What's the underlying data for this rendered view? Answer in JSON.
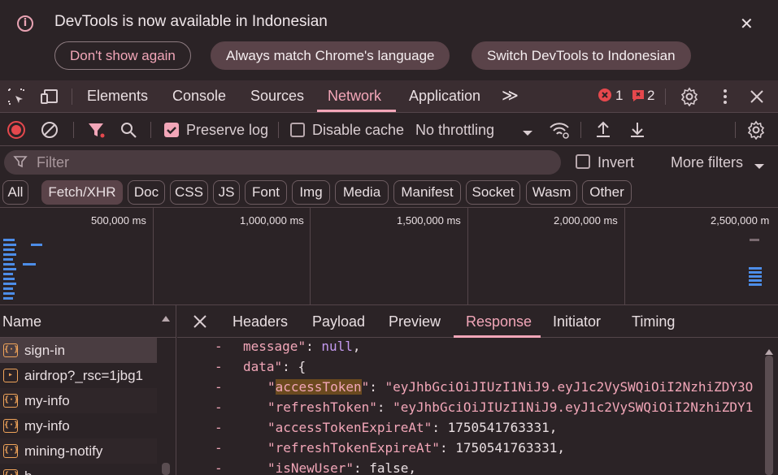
{
  "infobar": {
    "message": "DevTools is now available in Indonesian",
    "dont_show": "Don't show again",
    "always_match": "Always match Chrome's language",
    "switch": "Switch DevTools to Indonesian"
  },
  "main_tabs": {
    "elements": "Elements",
    "console": "Console",
    "sources": "Sources",
    "network": "Network",
    "application": "Application",
    "more": "≫",
    "error_count": "1",
    "issue_count": "2"
  },
  "toolbar": {
    "preserve_log": "Preserve log",
    "preserve_log_checked": true,
    "disable_cache": "Disable cache",
    "disable_cache_checked": false,
    "throttling": "No throttling"
  },
  "filter": {
    "placeholder": "Filter",
    "invert": "Invert",
    "more_filters": "More filters"
  },
  "type_filters": [
    "All",
    "Fetch/XHR",
    "Doc",
    "CSS",
    "JS",
    "Font",
    "Img",
    "Media",
    "Manifest",
    "Socket",
    "Wasm",
    "Other"
  ],
  "active_type_filter": "Fetch/XHR",
  "overview": {
    "ticks": [
      "500,000 ms",
      "1,000,000 ms",
      "1,500,000 ms",
      "2,000,000 ms",
      "2,500,000 m"
    ]
  },
  "requests": {
    "column": "Name",
    "items": [
      {
        "name": "sign-in",
        "icon": "{·}"
      },
      {
        "name": "airdrop?_rsc=1jbg1",
        "icon": "▸"
      },
      {
        "name": "my-info",
        "icon": "{·}"
      },
      {
        "name": "my-info",
        "icon": "{·}"
      },
      {
        "name": "mining-notify",
        "icon": "{·}"
      },
      {
        "name": "b...",
        "icon": "{·}"
      }
    ]
  },
  "detail": {
    "tabs": [
      "Headers",
      "Payload",
      "Preview",
      "Response",
      "Initiator",
      "Timing"
    ],
    "active_tab": "Response"
  },
  "response": {
    "lines": [
      {
        "key": "message",
        "value": "null",
        "type": "kw",
        "indent": 0,
        "partial_key": true
      },
      {
        "key": "data",
        "value": "{",
        "type": "p",
        "indent": 0
      },
      {
        "key": "accessToken",
        "value": "\"eyJhbGciOiJIUzI1NiJ9.eyJ1c2VySWQiOiI2NzhiZDY3O",
        "type": "s",
        "indent": 1,
        "highlight": "accessToken"
      },
      {
        "key": "refreshToken",
        "value": "\"eyJhbGciOiJIUzI1NiJ9.eyJ1c2VySWQiOiI2NzhiZDY1",
        "type": "s",
        "indent": 1
      },
      {
        "key": "accessTokenExpireAt",
        "value": "1750541763331,",
        "type": "n",
        "indent": 1,
        "highlight": "accessToken"
      },
      {
        "key": "refreshTokenExpireAt",
        "value": "1750541763331,",
        "type": "n",
        "indent": 1
      },
      {
        "key": "isNewUser",
        "value": "false,",
        "type": "kw_partial",
        "indent": 1
      }
    ]
  },
  "colors": {
    "accent": "#f2a6b8",
    "background": "#2b2326",
    "tabbar": "#3a2d31",
    "error": "#e5484d",
    "bar": "#4d8de8"
  }
}
